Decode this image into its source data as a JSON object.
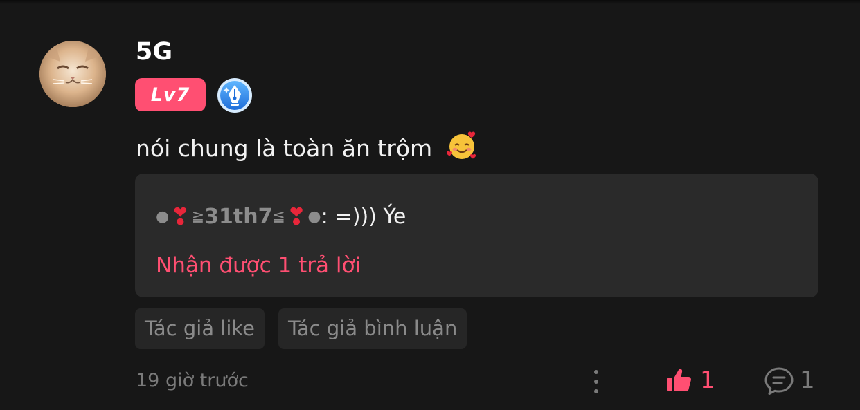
{
  "comment": {
    "username": "5G",
    "level_badge": "Lv7",
    "text": "nói chung là toàn ăn trộm",
    "emoji": "smiling-face-with-hearts"
  },
  "reply_preview": {
    "bullet": "●",
    "heart": "❣",
    "deco_left": "≧",
    "author": "31th7",
    "deco_right": "≦",
    "bullet_end": "●",
    "separator": ":",
    "text": "=))) Ýe",
    "reply_count_text": "Nhận được 1 trả lời"
  },
  "tags": [
    "Tác giả like",
    "Tác giả bình luận"
  ],
  "footer": {
    "timestamp": "19 giờ trước",
    "like_count": "1",
    "comment_count": "1"
  },
  "icons": {
    "more": "more-vertical-icon",
    "like": "thumbs-up-icon",
    "comment": "comment-bubble-icon",
    "writer_badge": "pen-nib-badge-icon"
  },
  "colors": {
    "background": "#171717",
    "accent": "#ff4f72",
    "card": "#2a2a2a",
    "tag_bg": "#262626",
    "muted": "#7a7a7a"
  }
}
